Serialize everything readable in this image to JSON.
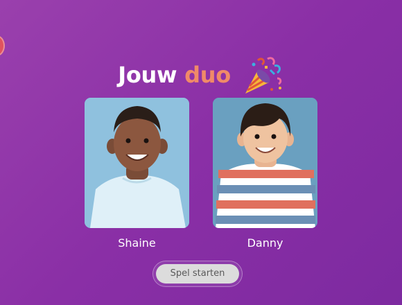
{
  "title": {
    "word1": "Jouw",
    "word2": "duo",
    "emoji": "party-popper-icon"
  },
  "players": [
    {
      "name": "Shaine"
    },
    {
      "name": "Danny"
    }
  ],
  "start_button": {
    "label": "Spel starten"
  },
  "colors": {
    "background": "#8a2fa6",
    "highlight": "#f08a68",
    "button": "#dcdcdc",
    "left_dot": "#e0535e"
  }
}
